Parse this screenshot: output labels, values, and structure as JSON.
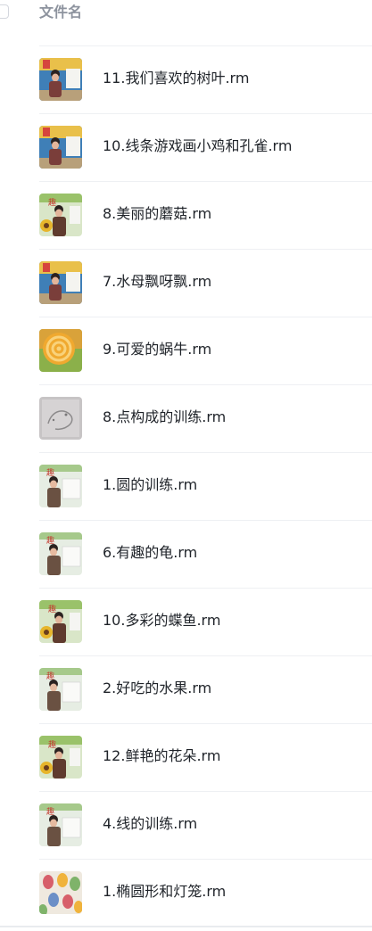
{
  "header": {
    "column_title": "文件名"
  },
  "files": [
    {
      "name": "11.我们喜欢的树叶.rm",
      "thumb": "classroom-teacher"
    },
    {
      "name": "10.线条游戏画小鸡和孔雀.rm",
      "thumb": "classroom-teacher"
    },
    {
      "name": "8.美丽的蘑菇.rm",
      "thumb": "teacher-sunflower"
    },
    {
      "name": "7.水母飘呀飘.rm",
      "thumb": "classroom-teacher"
    },
    {
      "name": "9.可爱的蜗牛.rm",
      "thumb": "snail-drawing"
    },
    {
      "name": "8.点构成的训练.rm",
      "thumb": "sketch-drawing"
    },
    {
      "name": "1.圆的训练.rm",
      "thumb": "teacher-board"
    },
    {
      "name": "6.有趣的龟.rm",
      "thumb": "teacher-board"
    },
    {
      "name": "10.多彩的蝶鱼.rm",
      "thumb": "teacher-sunflower"
    },
    {
      "name": "2.好吃的水果.rm",
      "thumb": "teacher-board"
    },
    {
      "name": "12.鲜艳的花朵.rm",
      "thumb": "teacher-sunflower"
    },
    {
      "name": "4.线的训练.rm",
      "thumb": "teacher-board"
    },
    {
      "name": "1.椭圆形和灯笼.rm",
      "thumb": "lantern-drawing"
    }
  ]
}
